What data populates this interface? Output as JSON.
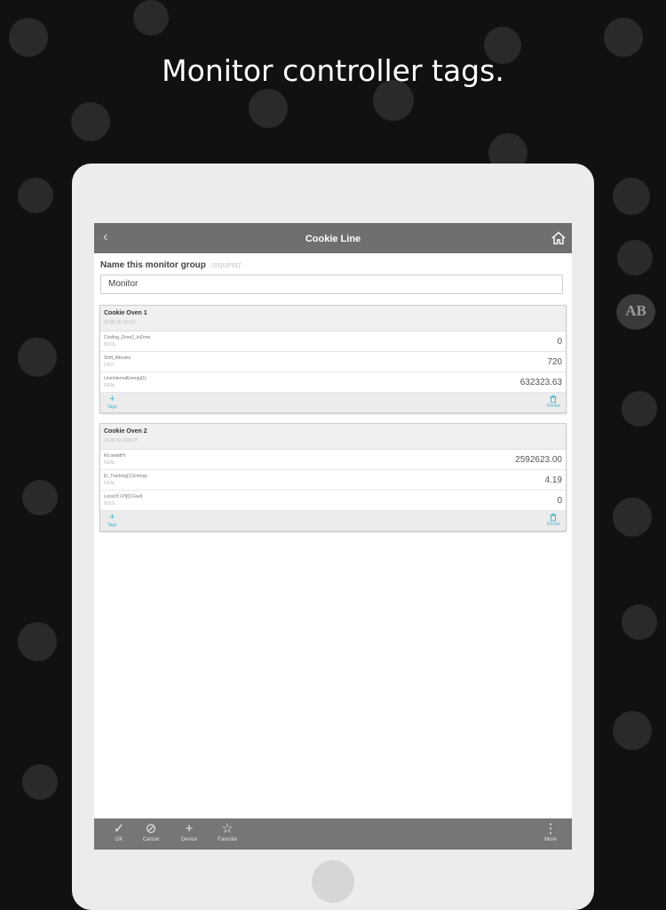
{
  "headline": "Monitor controller tags.",
  "brand_logo": "AB",
  "nav": {
    "back_icon": "‹",
    "title": "Cookie Line",
    "home_icon": "home-icon"
  },
  "group": {
    "label": "Name this monitor group",
    "required": "required",
    "name_value": "Monitor"
  },
  "devices": [
    {
      "name": "Cookie Oven 1",
      "address": "10.88.18.10/1/3",
      "tags": [
        {
          "name": "Cooling_Zone2_InZone",
          "type": "BOOL",
          "value": "0"
        },
        {
          "name": "Shift_Minutes",
          "type": "DINT",
          "value": "720"
        },
        {
          "name": "LineInternalEnergy[1]",
          "type": "REAL",
          "value": "632323.63"
        }
      ],
      "footer": {
        "tags_label": "Tags",
        "device_label": "Device"
      }
    },
    {
      "name": "Cookie Oven 2",
      "address": "10.88.53.104/1/3",
      "tags": [
        {
          "name": "KiLowattHr",
          "type": "REAL",
          "value": "2592623.00"
        },
        {
          "name": "El_Tracking[1].Energy",
          "type": "REAL",
          "value": "4.19"
        },
        {
          "name": "Local:8:I.Pt[0].Fault",
          "type": "BOOL",
          "value": "0"
        }
      ],
      "footer": {
        "tags_label": "Tags",
        "device_label": "Device"
      }
    }
  ],
  "toolbar": {
    "ok_label": "OK",
    "cancel_label": "Cancel",
    "device_label": "Device",
    "favorite_label": "Favorite",
    "more_label": "More"
  },
  "colors": {
    "nav": "#6f6f6f",
    "toolbar": "#767676",
    "accent": "#3fb3c9",
    "background": "#111111"
  }
}
